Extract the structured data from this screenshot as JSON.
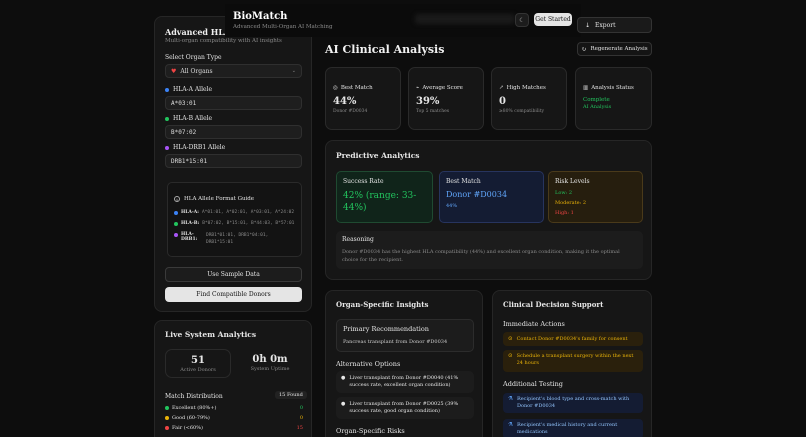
{
  "header": {
    "app_title": "BioMatch",
    "app_subtitle": "Advanced Multi-Organ AI Matching",
    "get_started": "Get Started",
    "export": "Export"
  },
  "left_panel": {
    "title": "Advanced HLA Anal",
    "subtitle": "Multi-organ compatibility with AI insights",
    "organ_type_label": "Select Organ Type",
    "organ_type_value": "All Organs",
    "hla_a_label": "HLA-A Allele",
    "hla_a_value": "A*03:01",
    "hla_b_label": "HLA-B Allele",
    "hla_b_value": "B*07:02",
    "hla_drb1_label": "HLA-DRB1 Allele",
    "hla_drb1_value": "DRB1*15:01",
    "guide": {
      "title": "HLA Allele Format Guide",
      "rows": [
        {
          "label": "HLA-A:",
          "value": "A*01:01, A*02:01, A*03:01, A*24:02"
        },
        {
          "label": "HLA-B:",
          "value": "B*07:02, B*15:01, B*44:03, B*57:01"
        },
        {
          "label": "HLA-DRB1:",
          "value": "DRB1*01:01, DRB1*04:01, DRB1*15:01"
        }
      ]
    },
    "use_sample": "Use Sample Data",
    "find_donors": "Find Compatible Donors"
  },
  "live_analytics": {
    "title": "Live System Analytics",
    "active_donors_value": "51",
    "active_donors_label": "Active Donors",
    "uptime_value": "0h 0m",
    "uptime_label": "System Uptime",
    "distribution_title": "Match Distribution",
    "found_badge": "15 Found",
    "rows": [
      {
        "label": "Excellent (80%+)",
        "count": "0",
        "color": "#22c55e"
      },
      {
        "label": "Good (60-79%)",
        "count": "0",
        "color": "#eab308"
      },
      {
        "label": "Fair (<60%)",
        "count": "15",
        "color": "#ef4444"
      }
    ]
  },
  "main": {
    "title": "AI Clinical Analysis",
    "regenerate": "Regenerate Analysis",
    "stats": [
      {
        "label": "Best Match",
        "value": "44%",
        "sub": "Donor #D0034"
      },
      {
        "label": "Average Score",
        "value": "39%",
        "sub": "Top 5 matches"
      },
      {
        "label": "High Matches",
        "value": "0",
        "sub": "≥80% compatibility"
      },
      {
        "label": "Analysis Status",
        "value": "Complete",
        "sub": "AI Analysis"
      }
    ]
  },
  "predictive": {
    "title": "Predictive Analytics",
    "success_label": "Success Rate",
    "success_value": "42% (range: 33-44%)",
    "best_label": "Best Match",
    "best_value": "Donor #D0034",
    "best_sub": "44%",
    "risk_label": "Risk Levels",
    "risk_low": "Low: 2",
    "risk_moderate": "Moderate: 2",
    "risk_high": "High: 1",
    "reasoning_label": "Reasoning",
    "reasoning_text": "Donor #D0034 has the highest HLA compatibility (44%) and excellent organ condition, making it the optimal choice for the recipient."
  },
  "organ_insights": {
    "title": "Organ-Specific Insights",
    "primary_label": "Primary Recommendation",
    "primary_value": "Pancreas transplant from Donor #D0034",
    "alternative_title": "Alternative Options",
    "alternatives": [
      "Liver transplant from Donor #D0040 (41% success rate, excellent organ condition)",
      "Liver transplant from Donor #D0025 (39% success rate, good organ condition)"
    ],
    "risks_title": "Organ-Specific Risks"
  },
  "clinical": {
    "title": "Clinical Decision Support",
    "immediate_title": "Immediate Actions",
    "immediate": [
      "Contact Donor #D0034's family for consent",
      "Schedule a transplant surgery within the next 24 hours"
    ],
    "testing_title": "Additional Testing",
    "testing": [
      "Recipient's blood type and cross-match with Donor #D0034",
      "Recipient's medical history and current medications"
    ]
  }
}
